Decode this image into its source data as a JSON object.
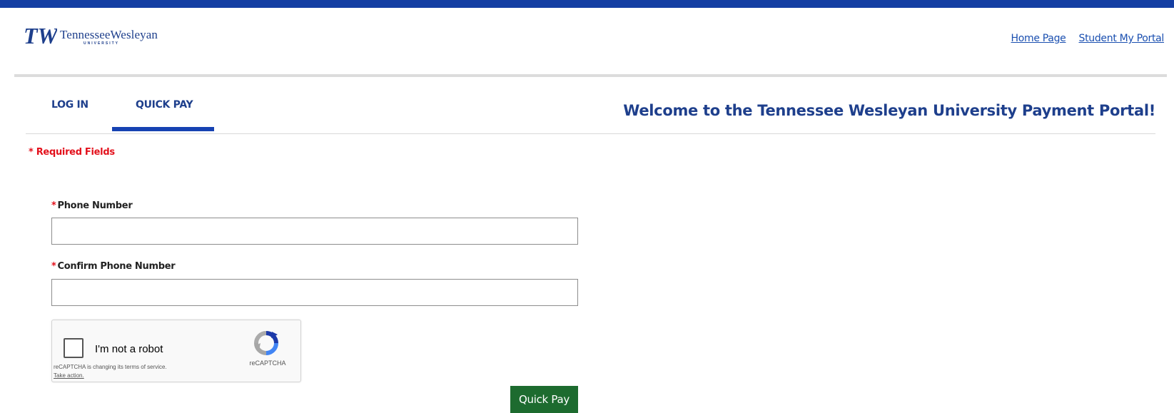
{
  "header": {
    "logo": {
      "monogram": "TW",
      "name": "TennesseeWesleyan",
      "subtitle": "UNIVERSITY"
    },
    "links": {
      "home": "Home Page",
      "portal": "Student My Portal"
    }
  },
  "tabs": {
    "login": "LOG IN",
    "quick_pay": "QUICK PAY",
    "active": "quick_pay"
  },
  "welcome_title": "Welcome to the Tennessee Wesleyan University Payment Portal!",
  "form": {
    "required_note": "* Required Fields",
    "required_marker": "*",
    "phone": {
      "label": "Phone Number",
      "value": ""
    },
    "confirm_phone": {
      "label": "Confirm Phone Number",
      "value": ""
    },
    "recaptcha": {
      "label": "I'm not a robot",
      "brand": "reCAPTCHA",
      "terms_notice": "reCAPTCHA is changing its terms of service.",
      "action": "Take action."
    },
    "submit_label": "Quick Pay"
  },
  "colors": {
    "brand_blue": "#143ea3",
    "heading_blue": "#1e3f8c",
    "link_blue": "#1a4fb0",
    "required_red": "#e3111c",
    "button_green": "#1d6b2f"
  },
  "icons": {
    "logo": "tw-monogram-logo",
    "recaptcha": "recaptcha-icon"
  }
}
